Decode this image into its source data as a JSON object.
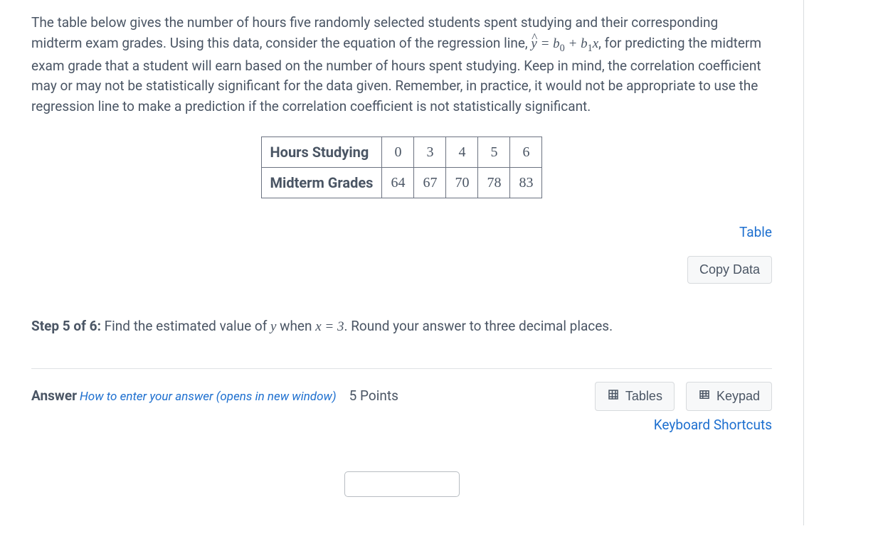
{
  "problem": {
    "p1": "The table below gives the number of hours five randomly selected students spent studying and their corresponding midterm exam grades. Using this data, consider the equation of the regression line, ",
    "eq_yhat": "ŷ",
    "eq_rest": " = b₀ + b₁x",
    "p2": ", for predicting the midterm exam grade that a student will earn based on the number of hours spent studying. Keep in mind, the correlation coefficient may or may not be statistically significant for the data given. Remember, in practice, it would not be appropriate to use the regression line to make a prediction if the correlation coefficient is not statistically significant."
  },
  "table": {
    "row1_label": "Hours Studying",
    "row1": [
      "0",
      "3",
      "4",
      "5",
      "6"
    ],
    "row2_label": "Midterm Grades",
    "row2": [
      "64",
      "67",
      "70",
      "78",
      "83"
    ]
  },
  "links": {
    "table_link": "Table",
    "copy_data": "Copy Data"
  },
  "step": {
    "label": "Step 5 of 6:",
    "text_a": " Find the estimated value of ",
    "y": "y",
    "text_b": " when ",
    "x": "x",
    "eqv": " = 3",
    "text_c": ". Round your answer to three decimal places."
  },
  "answer": {
    "label": "Answer",
    "hint": "How to enter your answer (opens in new window)",
    "points": "5 Points",
    "tables_btn": "Tables",
    "keypad_btn": "Keypad",
    "shortcuts": "Keyboard Shortcuts"
  },
  "chart_data": {
    "type": "table",
    "title": "Hours Studying vs Midterm Grades",
    "columns": [
      "Hours Studying",
      "Midterm Grades"
    ],
    "rows": [
      {
        "Hours Studying": 0,
        "Midterm Grades": 64
      },
      {
        "Hours Studying": 3,
        "Midterm Grades": 67
      },
      {
        "Hours Studying": 4,
        "Midterm Grades": 70
      },
      {
        "Hours Studying": 5,
        "Midterm Grades": 78
      },
      {
        "Hours Studying": 6,
        "Midterm Grades": 83
      }
    ]
  }
}
